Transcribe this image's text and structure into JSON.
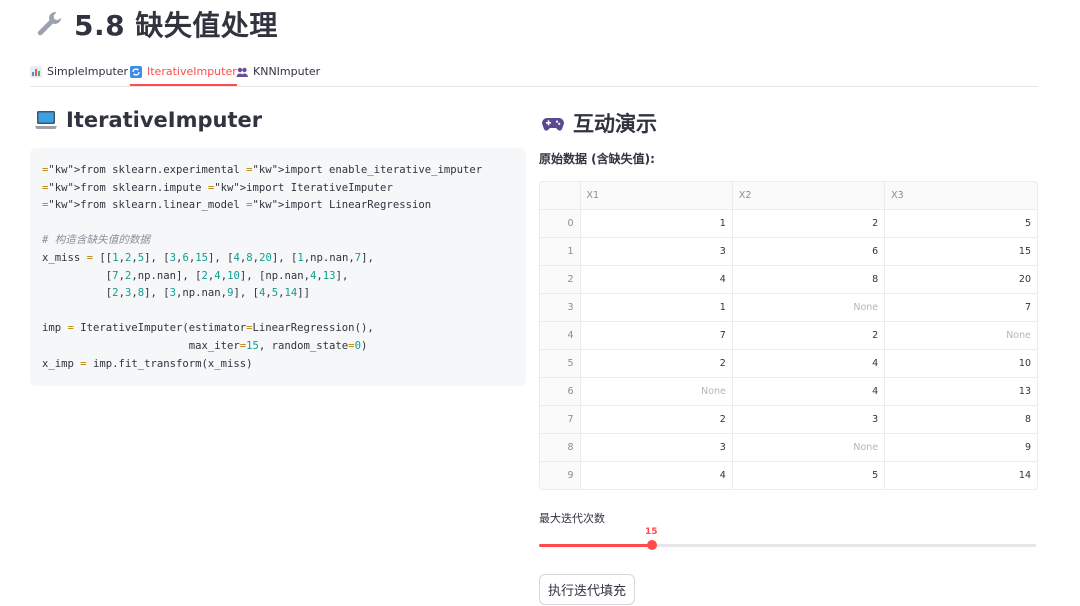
{
  "page": {
    "title": "5.8 缺失值处理",
    "title_icon": "wrench-icon"
  },
  "tabs": [
    {
      "label": "SimpleImputer",
      "icon": "bar-chart-icon",
      "active": false
    },
    {
      "label": "IterativeImputer",
      "icon": "refresh-icon",
      "active": true
    },
    {
      "label": "KNNImputer",
      "icon": "users-icon",
      "active": false
    }
  ],
  "left": {
    "heading": "IterativeImputer",
    "heading_icon": "laptop-icon",
    "code_lines": [
      "from sklearn.experimental import enable_iterative_imputer",
      "from sklearn.impute import IterativeImputer",
      "from sklearn.linear_model import LinearRegression",
      "",
      "# 构造含缺失值的数据",
      "x_miss = [[1,2,5], [3,6,15], [4,8,20], [1,np.nan,7],",
      "          [7,2,np.nan], [2,4,10], [np.nan,4,13],",
      "          [2,3,8], [3,np.nan,9], [4,5,14]]",
      "",
      "imp = IterativeImputer(estimator=LinearRegression(),",
      "                       max_iter=15, random_state=0)",
      "x_imp = imp.fit_transform(x_miss)"
    ]
  },
  "right": {
    "heading": "互动演示",
    "heading_icon": "gamepad-icon",
    "data_label": "原始数据 (含缺失值):",
    "table": {
      "columns": [
        "",
        "X1",
        "X2",
        "X3"
      ],
      "rows": [
        [
          "0",
          "1",
          "2",
          "5"
        ],
        [
          "1",
          "3",
          "6",
          "15"
        ],
        [
          "2",
          "4",
          "8",
          "20"
        ],
        [
          "3",
          "1",
          "None",
          "7"
        ],
        [
          "4",
          "7",
          "2",
          "None"
        ],
        [
          "5",
          "2",
          "4",
          "10"
        ],
        [
          "6",
          "None",
          "4",
          "13"
        ],
        [
          "7",
          "2",
          "3",
          "8"
        ],
        [
          "8",
          "3",
          "None",
          "9"
        ],
        [
          "9",
          "4",
          "5",
          "14"
        ]
      ]
    },
    "slider": {
      "label": "最大迭代次数",
      "value": "15",
      "fraction": 0.228
    },
    "button_label": "执行迭代填充"
  },
  "colors": {
    "accent": "#ff4b4b",
    "text": "#31333f",
    "code_bg": "#f6f7f9"
  }
}
